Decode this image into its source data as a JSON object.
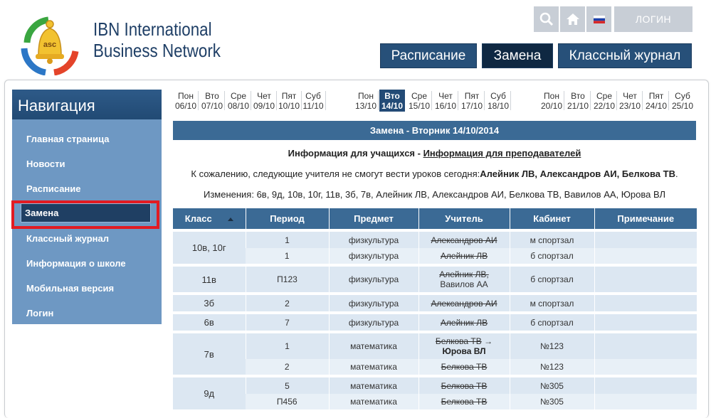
{
  "brand": {
    "line1": "IBN International",
    "line2": "Business Network",
    "logo_text": "asc"
  },
  "topbar": {
    "search_icon": "search-icon",
    "home_icon": "home-icon",
    "flag_icon": "russia-flag-icon",
    "login_label": "ЛОГИН"
  },
  "mainnav": [
    {
      "label": "Расписание"
    },
    {
      "label": "Замена"
    },
    {
      "label": "Классный журнал"
    }
  ],
  "sidebar": {
    "title": "Навигация",
    "items": [
      {
        "label": "Главная страница"
      },
      {
        "label": "Новости"
      },
      {
        "label": "Расписание"
      },
      {
        "label": "Замена"
      },
      {
        "label": "Классный журнал"
      },
      {
        "label": "Информация о школе"
      },
      {
        "label": "Мобильная версия"
      },
      {
        "label": "Логин"
      }
    ]
  },
  "weeks": [
    [
      {
        "day": "Пон",
        "date": "06/10"
      },
      {
        "day": "Вто",
        "date": "07/10"
      },
      {
        "day": "Сре",
        "date": "08/10"
      },
      {
        "day": "Чет",
        "date": "09/10"
      },
      {
        "day": "Пят",
        "date": "10/10"
      },
      {
        "day": "Суб",
        "date": "11/10"
      }
    ],
    [
      {
        "day": "Пон",
        "date": "13/10"
      },
      {
        "day": "Вто",
        "date": "14/10"
      },
      {
        "day": "Сре",
        "date": "15/10"
      },
      {
        "day": "Чет",
        "date": "16/10"
      },
      {
        "day": "Пят",
        "date": "17/10"
      },
      {
        "day": "Суб",
        "date": "18/10"
      }
    ],
    [
      {
        "day": "Пон",
        "date": "20/10"
      },
      {
        "day": "Вто",
        "date": "21/10"
      },
      {
        "day": "Сре",
        "date": "22/10"
      },
      {
        "day": "Чет",
        "date": "23/10"
      },
      {
        "day": "Пят",
        "date": "24/10"
      },
      {
        "day": "Суб",
        "date": "25/10"
      }
    ]
  ],
  "content": {
    "title": "Замена - Вторник 14/10/2014",
    "info_students": "Информация для учащихся",
    "info_dash": " - ",
    "info_teachers": "Информация для преподавателей",
    "absent_prefix": "К сожалению, следующие учителя не смогут вести уроков сегодня:",
    "absent_names": "Алейник ЛВ, Александров АИ, Белкова ТВ",
    "absent_suffix": ".",
    "changes": "Изменения: 6в, 9д, 10в, 10г, 11в, 3б, 7в, Алейник ЛВ, Александров АИ, Белкова ТВ, Вавилов АА, Юрова ВЛ"
  },
  "table": {
    "headers": [
      "Класс",
      "Период",
      "Предмет",
      "Учитель",
      "Кабинет",
      "Примечание"
    ],
    "groups": [
      {
        "class": "10в, 10г",
        "rows": [
          {
            "period": "1",
            "subject": "физкультура",
            "teacher_old": "Александров АИ",
            "teacher_new": "",
            "room": "м спортзал",
            "note": ""
          },
          {
            "period": "1",
            "subject": "физкультура",
            "teacher_old": "Алейник ЛВ",
            "teacher_new": "",
            "room": "б спортзал",
            "note": ""
          }
        ]
      },
      {
        "class": "11в",
        "rows": [
          {
            "period": "П123",
            "subject": "физкультура",
            "teacher_old": "Алейник ЛВ,",
            "teacher_extra": "Вавилов АА",
            "teacher_new": "",
            "room": "б спортзал",
            "note": ""
          }
        ]
      },
      {
        "class": "3б",
        "rows": [
          {
            "period": "2",
            "subject": "физкультура",
            "teacher_old": "Александров АИ",
            "teacher_new": "",
            "room": "м спортзал",
            "note": ""
          }
        ]
      },
      {
        "class": "6в",
        "rows": [
          {
            "period": "7",
            "subject": "физкультура",
            "teacher_old": "Алейник ЛВ",
            "teacher_new": "",
            "room": "б спортзал",
            "note": ""
          }
        ]
      },
      {
        "class": "7в",
        "rows": [
          {
            "period": "1",
            "subject": "математика",
            "teacher_old": "Белкова ТВ",
            "arrow": "→",
            "teacher_new": "Юрова ВЛ",
            "room": "№123",
            "note": ""
          },
          {
            "period": "2",
            "subject": "математика",
            "teacher_old": "Белкова ТВ",
            "teacher_new": "",
            "room": "№123",
            "note": ""
          }
        ]
      },
      {
        "class": "9д",
        "rows": [
          {
            "period": "5",
            "subject": "математика",
            "teacher_old": "Белкова ТВ",
            "teacher_new": "",
            "room": "№305",
            "note": ""
          },
          {
            "period": "П456",
            "subject": "математика",
            "teacher_old": "Белкова ТВ",
            "teacher_new": "",
            "room": "№305",
            "note": ""
          }
        ]
      }
    ]
  }
}
